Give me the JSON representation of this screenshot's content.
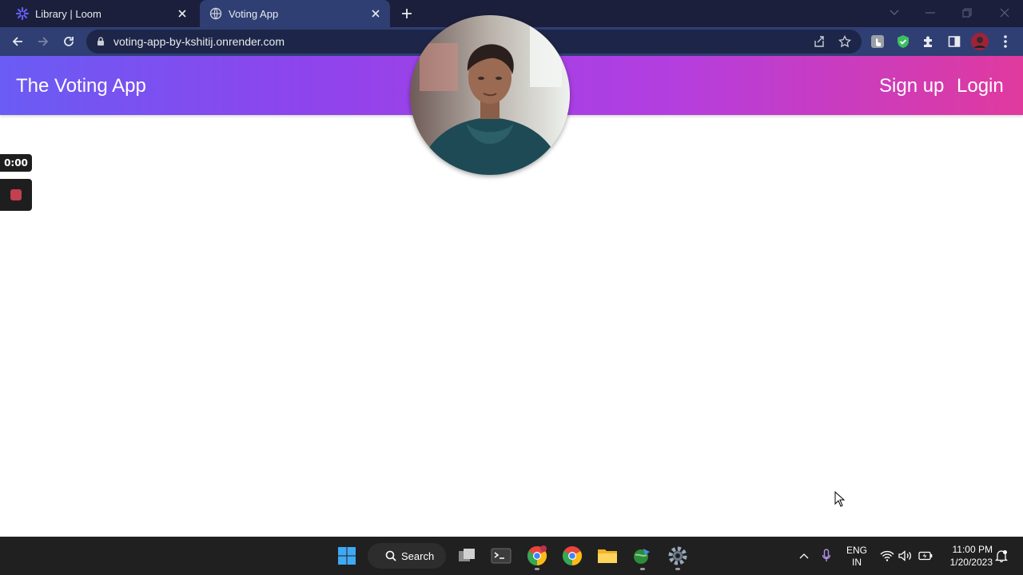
{
  "browser": {
    "tabs": [
      {
        "title": "Library | Loom",
        "favicon": "loom-icon",
        "active": false
      },
      {
        "title": "Voting App",
        "favicon": "globe-icon",
        "active": true
      }
    ],
    "url": "voting-app-by-kshitij.onrender.com"
  },
  "navbar": {
    "brand": "The Voting App",
    "links": [
      "Sign up",
      "Login"
    ],
    "gradient": [
      "#6a5cf4",
      "#8e44ec",
      "#b33ee0",
      "#e03a9e"
    ]
  },
  "recorder": {
    "timer": "0:00"
  },
  "taskbar": {
    "search_label": "Search",
    "language": "ENG",
    "region": "IN",
    "time": "11:00 PM",
    "date": "1/20/2023"
  },
  "colors": {
    "tabstrip_bg": "#1b1f3b",
    "toolbar_bg": "#2f3f73",
    "taskbar_bg": "#202020"
  }
}
